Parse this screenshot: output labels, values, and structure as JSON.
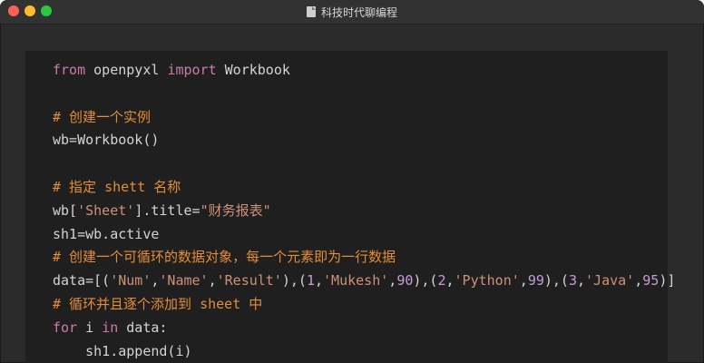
{
  "window": {
    "title": "科技时代聊编程"
  },
  "code": {
    "lines": [
      {
        "tokens": [
          {
            "t": "from",
            "c": "kw"
          },
          {
            "t": " openpyxl ",
            "c": "fn"
          },
          {
            "t": "import",
            "c": "kw"
          },
          {
            "t": " Workbook",
            "c": "fn"
          }
        ]
      },
      {
        "tokens": []
      },
      {
        "tokens": [
          {
            "t": "# 创建一个实例",
            "c": "cm"
          }
        ]
      },
      {
        "tokens": [
          {
            "t": "wb=Workbook()",
            "c": "fn"
          }
        ]
      },
      {
        "tokens": []
      },
      {
        "tokens": [
          {
            "t": "# 指定 shett 名称",
            "c": "cm"
          }
        ]
      },
      {
        "tokens": [
          {
            "t": "wb[",
            "c": "fn"
          },
          {
            "t": "'Sheet'",
            "c": "str"
          },
          {
            "t": "].title=",
            "c": "fn"
          },
          {
            "t": "\"财务报表\"",
            "c": "str"
          }
        ]
      },
      {
        "tokens": [
          {
            "t": "sh1=wb.active",
            "c": "fn"
          }
        ]
      },
      {
        "tokens": [
          {
            "t": "# 创建一个可循环的数据对象，每一个元素即为一行数据",
            "c": "cm"
          }
        ]
      },
      {
        "tokens": [
          {
            "t": "data=[(",
            "c": "fn"
          },
          {
            "t": "'Num'",
            "c": "str"
          },
          {
            "t": ",",
            "c": "fn"
          },
          {
            "t": "'Name'",
            "c": "str"
          },
          {
            "t": ",",
            "c": "fn"
          },
          {
            "t": "'Result'",
            "c": "str"
          },
          {
            "t": "),(",
            "c": "fn"
          },
          {
            "t": "1",
            "c": "num"
          },
          {
            "t": ",",
            "c": "fn"
          },
          {
            "t": "'Mukesh'",
            "c": "str"
          },
          {
            "t": ",",
            "c": "fn"
          },
          {
            "t": "90",
            "c": "num"
          },
          {
            "t": "),(",
            "c": "fn"
          },
          {
            "t": "2",
            "c": "num"
          },
          {
            "t": ",",
            "c": "fn"
          },
          {
            "t": "'Python'",
            "c": "str"
          },
          {
            "t": ",",
            "c": "fn"
          },
          {
            "t": "99",
            "c": "num"
          },
          {
            "t": "),(",
            "c": "fn"
          },
          {
            "t": "3",
            "c": "num"
          },
          {
            "t": ",",
            "c": "fn"
          },
          {
            "t": "'Java'",
            "c": "str"
          },
          {
            "t": ",",
            "c": "fn"
          },
          {
            "t": "95",
            "c": "num"
          },
          {
            "t": ")]",
            "c": "fn"
          }
        ]
      },
      {
        "tokens": [
          {
            "t": "# 循环并且逐个添加到 sheet 中",
            "c": "cm"
          }
        ]
      },
      {
        "tokens": [
          {
            "t": "for",
            "c": "kw"
          },
          {
            "t": " i ",
            "c": "fn"
          },
          {
            "t": "in",
            "c": "kw"
          },
          {
            "t": " data:",
            "c": "fn"
          }
        ]
      },
      {
        "tokens": [
          {
            "t": "    sh1.append(i)",
            "c": "fn"
          }
        ]
      }
    ]
  },
  "colors": {
    "keyword": "#cc7ba7",
    "comment": "#e38d38",
    "string": "#ce9178",
    "number": "#c79bd9",
    "text": "#d4d4d4",
    "editor_bg": "#1f1f1f",
    "window_bg": "#2b2b2b"
  }
}
